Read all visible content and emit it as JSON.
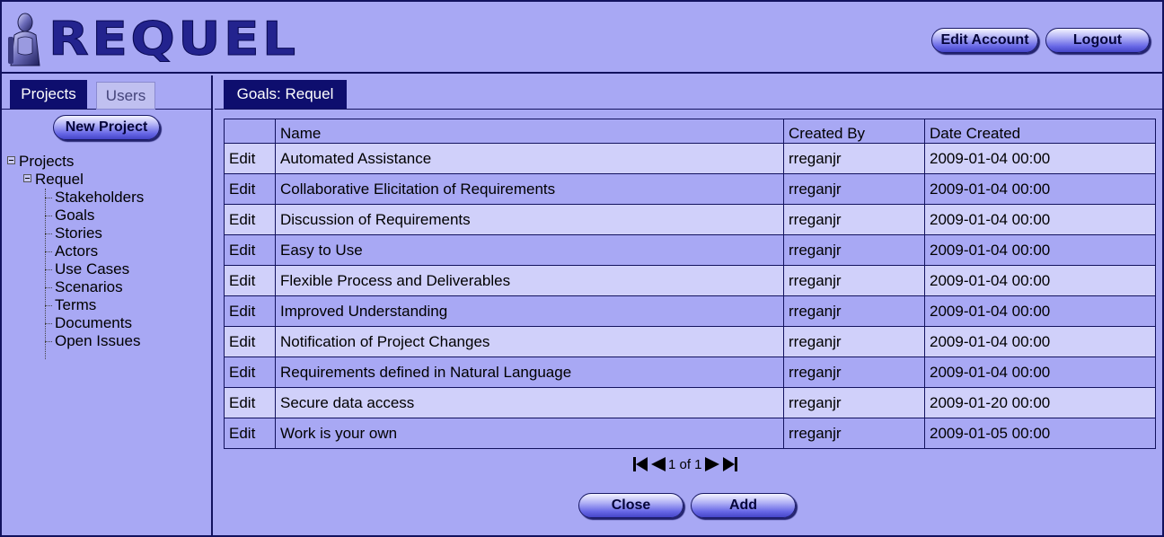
{
  "app": {
    "logo_text": "REQUEL"
  },
  "header": {
    "edit_account_label": "Edit Account",
    "logout_label": "Logout"
  },
  "sidebar": {
    "tabs": [
      {
        "label": "Projects",
        "active": true
      },
      {
        "label": "Users",
        "active": false
      }
    ],
    "new_project_label": "New Project",
    "tree": {
      "root_label": "Projects",
      "project_label": "Requel",
      "items": [
        {
          "label": "Stakeholders"
        },
        {
          "label": "Goals"
        },
        {
          "label": "Stories"
        },
        {
          "label": "Actors"
        },
        {
          "label": "Use Cases"
        },
        {
          "label": "Scenarios"
        },
        {
          "label": "Terms"
        },
        {
          "label": "Documents"
        },
        {
          "label": "Open Issues"
        }
      ]
    }
  },
  "main": {
    "tab_label": "Goals: Requel",
    "table": {
      "columns": [
        "",
        "Name",
        "Created By",
        "Date Created"
      ],
      "rows": [
        {
          "edit": "Edit",
          "name": "Automated Assistance",
          "created_by": "rreganjr",
          "date_created": "2009-01-04 00:00"
        },
        {
          "edit": "Edit",
          "name": "Collaborative Elicitation of Requirements",
          "created_by": "rreganjr",
          "date_created": "2009-01-04 00:00"
        },
        {
          "edit": "Edit",
          "name": "Discussion of Requirements",
          "created_by": "rreganjr",
          "date_created": "2009-01-04 00:00"
        },
        {
          "edit": "Edit",
          "name": "Easy to Use",
          "created_by": "rreganjr",
          "date_created": "2009-01-04 00:00"
        },
        {
          "edit": "Edit",
          "name": "Flexible Process and Deliverables",
          "created_by": "rreganjr",
          "date_created": "2009-01-04 00:00"
        },
        {
          "edit": "Edit",
          "name": "Improved Understanding",
          "created_by": "rreganjr",
          "date_created": "2009-01-04 00:00"
        },
        {
          "edit": "Edit",
          "name": "Notification of Project Changes",
          "created_by": "rreganjr",
          "date_created": "2009-01-04 00:00"
        },
        {
          "edit": "Edit",
          "name": "Requirements defined in Natural Language",
          "created_by": "rreganjr",
          "date_created": "2009-01-04 00:00"
        },
        {
          "edit": "Edit",
          "name": "Secure data access",
          "created_by": "rreganjr",
          "date_created": "2009-01-20 00:00"
        },
        {
          "edit": "Edit",
          "name": "Work is your own",
          "created_by": "rreganjr",
          "date_created": "2009-01-05 00:00"
        }
      ]
    },
    "pager": {
      "text": "1 of 1",
      "icons": [
        "first-page-icon",
        "prev-page-icon",
        "next-page-icon",
        "last-page-icon"
      ]
    },
    "close_label": "Close",
    "add_label": "Add"
  },
  "colors": {
    "background": "#a8a8f4",
    "row_alt": "#d0d0fa",
    "tab_active": "#0e0e6e",
    "border": "#12125e"
  }
}
